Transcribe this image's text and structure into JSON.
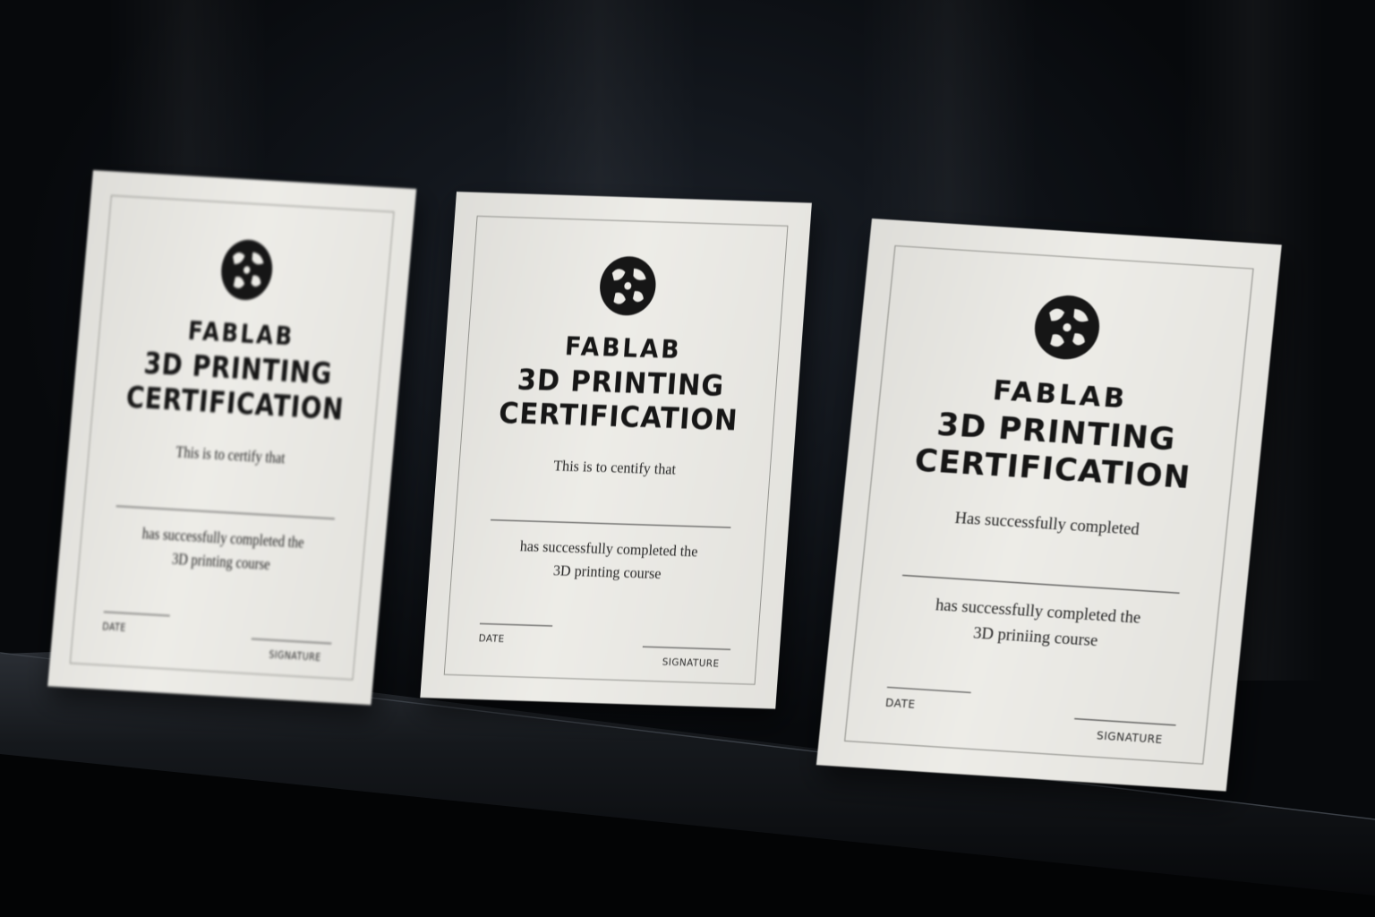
{
  "cards": [
    {
      "title_line1": "FABLAB",
      "title_line2": "3D PRINTING",
      "title_line3": "CERTIFICATION",
      "intro": "This is to certify that",
      "body_line1": "has successfully completed the",
      "body_line2": "3D printing course",
      "date_label": "DATE",
      "signature_label": "SIGNATURE"
    },
    {
      "title_line1": "FABLAB",
      "title_line2": "3D PRINTING",
      "title_line3": "CERTIFICATION",
      "intro": "This is to centify that",
      "body_line1": "has successfully completed the",
      "body_line2": "3D printing course",
      "date_label": "DATE",
      "signature_label": "SIGNATURE"
    },
    {
      "title_line1": "FABLAB",
      "title_line2": "3D PRINTING",
      "title_line3": "CERTIFICATION",
      "intro": "Has successfully completed",
      "body_line1": "has successfully completed the",
      "body_line2": "3D priniing course",
      "date_label": "DATE",
      "signature_label": "SIGNATURE"
    }
  ],
  "logo_icon": "fablab-logo-icon",
  "colors": {
    "background": "#0a0c10",
    "card": "#ecebe6",
    "ink": "#161616"
  }
}
